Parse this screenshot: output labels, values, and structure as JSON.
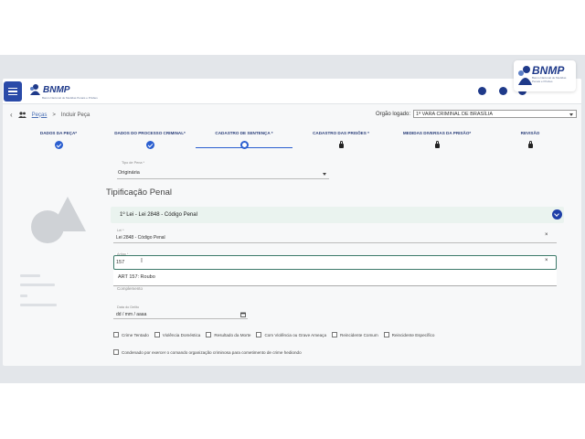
{
  "app": {
    "logo_text": "BNMP",
    "logo_subtitle": "Banco Nacional de Medidas Penais e Prisões"
  },
  "breadcrumb": {
    "items": [
      "Peças",
      ">",
      "Incluir Peça"
    ]
  },
  "org": {
    "label": "Orgão logado:",
    "value": "1ª VARA CRIMINAL DE BRASÍLIA"
  },
  "steps": [
    {
      "label": "DADOS DA PEÇA*",
      "state": "done"
    },
    {
      "label": "DADOS DO PROCESSO CRIMINAL*",
      "state": "done"
    },
    {
      "label": "CADASTRO DE SENTENÇA *",
      "state": "current"
    },
    {
      "label": "CADASTRO DAS PRISÕES *",
      "state": "locked"
    },
    {
      "label": "MEDIDAS DIVERSAS DA PRISÃO*",
      "state": "locked"
    },
    {
      "label": "REVISÃO",
      "state": "locked"
    }
  ],
  "form": {
    "tipo_pena_label": "Tipo de Pena *",
    "tipo_pena_value": "Originária",
    "section_title": "Tipificação Penal",
    "accordion_title": "1º Lei - Lei 2848 - Código Penal",
    "lei_label": "Lei *",
    "lei_value": "Lei 2848 - Código Penal",
    "artigo_label": "Artigo *",
    "artigo_value": "157",
    "suggestion": "ART 157: Roubo",
    "complemento_placeholder": "Complemento",
    "data_label": "Data do Delito",
    "data_placeholder": "dd / mm / aaaa"
  },
  "checkboxes": [
    "Crime Tentado",
    "Violência Doméstica",
    "Resultado da Morte",
    "Com Violência ou Grave Ameaça",
    "Reincidente Comum",
    "Reincidente Específico"
  ],
  "checkbox_long": "Condenado por exercer o comando organização criminosa para cometimento de crime hediondo",
  "colors": {
    "primary": "#1f3fa8",
    "step_text": "#2b3f7a",
    "accordion_bg": "#eaf3ef",
    "active_border": "#3d7a6a"
  }
}
